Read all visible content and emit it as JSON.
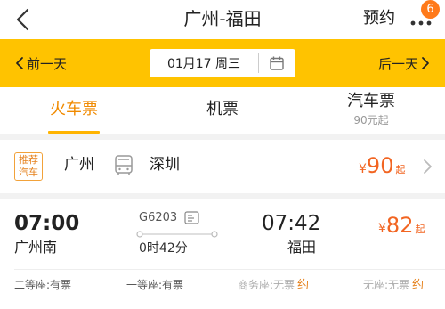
{
  "header": {
    "title": "广州-福田",
    "reserve_label": "预约",
    "badge_count": "6"
  },
  "datebar": {
    "prev_label": "前一天",
    "date": "01月17 周三",
    "next_label": "后一天"
  },
  "tabs": [
    {
      "label": "火车票",
      "active": true
    },
    {
      "label": "机票"
    },
    {
      "label": "汽车票",
      "sub": "90元起"
    }
  ],
  "bus_card": {
    "tag": "推荐汽车",
    "tag_line1": "推荐",
    "tag_line2": "汽车",
    "from": "广州",
    "to": "深圳",
    "price_symbol": "¥",
    "price": "90",
    "price_suffix": "起"
  },
  "train": {
    "departure_time": "07:00",
    "departure_station": "广州南",
    "train_number": "G6203",
    "duration": "0时42分",
    "arrival_time": "07:42",
    "arrival_station": "福田",
    "price_symbol": "¥",
    "price": "82",
    "price_suffix": "起",
    "seats": [
      {
        "label": "二等座:有票"
      },
      {
        "label": "一等座:有票"
      },
      {
        "label": "商务座:无票",
        "action": "约"
      },
      {
        "label": "无座:无票",
        "action": "约"
      }
    ]
  },
  "colors": {
    "accent_yellow": "#ffc300",
    "price_orange": "#f26522",
    "active_tab": "#f08a00"
  }
}
